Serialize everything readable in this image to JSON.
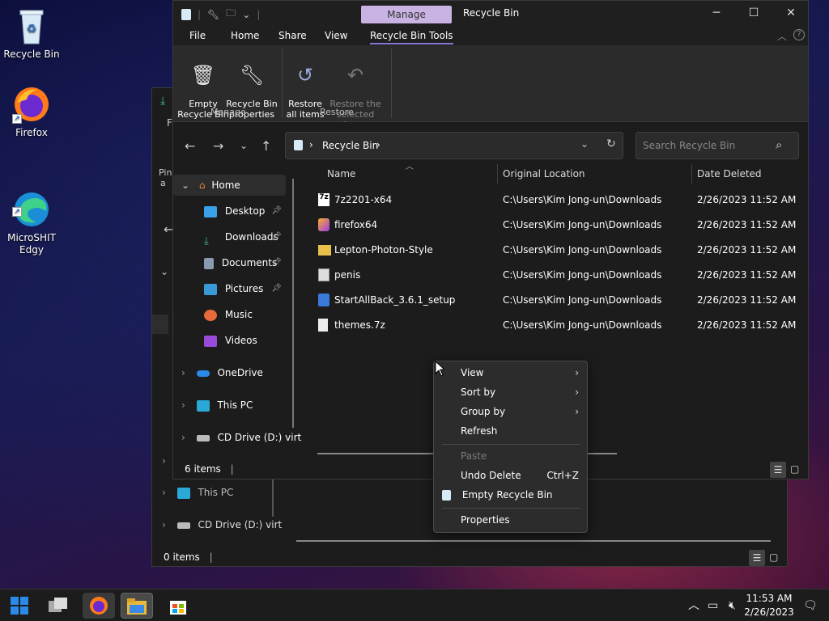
{
  "desktop": {
    "icons": [
      {
        "label": "Recycle Bin"
      },
      {
        "label": "Firefox"
      },
      {
        "label": "MicroSHIT\nEdgy"
      }
    ]
  },
  "back_window": {
    "frag_f": "F",
    "frag_pin": "Pin",
    "frag_a": "a",
    "side": [
      {
        "label": "This PC"
      },
      {
        "label": "CD Drive (D:) virt"
      }
    ],
    "status": "0 items"
  },
  "window": {
    "manage_tab": "Manage",
    "title": "Recycle Bin",
    "menu": [
      "File",
      "Home",
      "Share",
      "View",
      "Recycle Bin Tools"
    ],
    "ribbon": {
      "empty": "Empty\nRecycle Bin",
      "properties": "Recycle Bin\nproperties",
      "restore_all": "Restore\nall items",
      "restore_sel": "Restore the\nselected items",
      "group_manage": "Manage",
      "group_restore": "Restore"
    },
    "address": {
      "path": "Recycle Bin",
      "search_placeholder": "Search Recycle Bin"
    },
    "sidebar": [
      {
        "label": "Home"
      },
      {
        "label": "Desktop"
      },
      {
        "label": "Downloads"
      },
      {
        "label": "Documents"
      },
      {
        "label": "Pictures"
      },
      {
        "label": "Music"
      },
      {
        "label": "Videos"
      },
      {
        "label": "OneDrive"
      },
      {
        "label": "This PC"
      },
      {
        "label": "CD Drive (D:) virt"
      }
    ],
    "columns": {
      "name": "Name",
      "location": "Original Location",
      "date": "Date Deleted"
    },
    "files": [
      {
        "name": "7z2201-x64",
        "location": "C:\\Users\\Kim Jong-un\\Downloads",
        "date": "2/26/2023 11:52 AM"
      },
      {
        "name": "firefox64",
        "location": "C:\\Users\\Kim Jong-un\\Downloads",
        "date": "2/26/2023 11:52 AM"
      },
      {
        "name": "Lepton-Photon-Style",
        "location": "C:\\Users\\Kim Jong-un\\Downloads",
        "date": "2/26/2023 11:52 AM"
      },
      {
        "name": "penis",
        "location": "C:\\Users\\Kim Jong-un\\Downloads",
        "date": "2/26/2023 11:52 AM"
      },
      {
        "name": "StartAllBack_3.6.1_setup",
        "location": "C:\\Users\\Kim Jong-un\\Downloads",
        "date": "2/26/2023 11:52 AM"
      },
      {
        "name": "themes.7z",
        "location": "C:\\Users\\Kim Jong-un\\Downloads",
        "date": "2/26/2023 11:52 AM"
      }
    ],
    "status": "6 items"
  },
  "context_menu": {
    "view": "View",
    "sort_by": "Sort by",
    "group_by": "Group by",
    "refresh": "Refresh",
    "paste": "Paste",
    "undo_delete": "Undo Delete",
    "undo_shortcut": "Ctrl+Z",
    "empty_bin": "Empty Recycle Bin",
    "properties": "Properties"
  },
  "taskbar": {
    "time": "11:53 AM",
    "date": "2/26/2023"
  }
}
